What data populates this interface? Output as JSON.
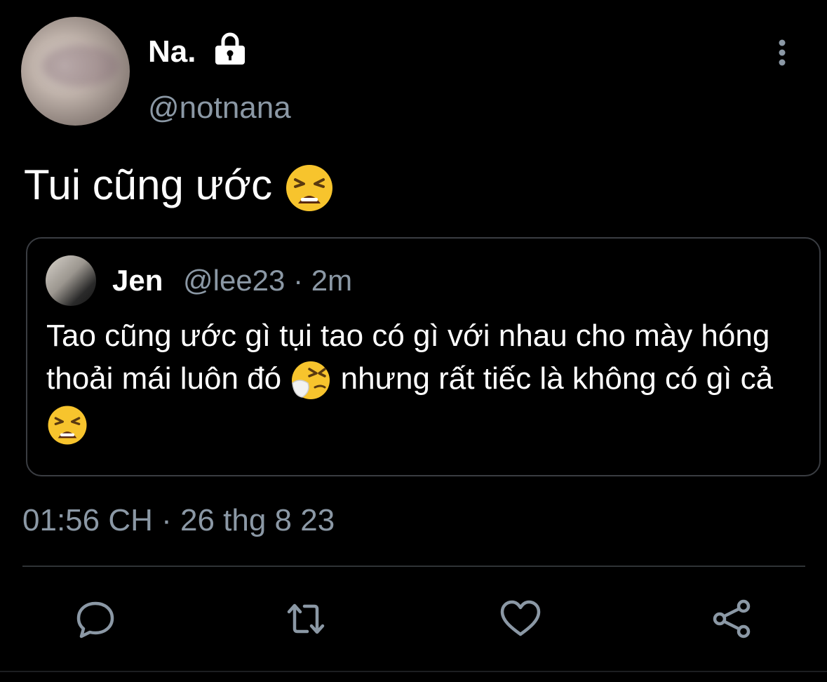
{
  "author": {
    "display_name": "Na.",
    "handle": "@notnana",
    "protected_icon": "lock-icon"
  },
  "menu_icon": "more-vertical-icon",
  "tweet": {
    "text": "Tui cũng ước",
    "emoji": "weary-face"
  },
  "quoted_tweet": {
    "display_name": "Jen",
    "handle_time": "@lee23 · 2m",
    "text_part1": "Tao cũng ước gì tụi tao có gì với nhau cho mày hóng thoải mái luôn đó",
    "emoji1": "sneezing-face",
    "text_part2": "nhưng rất tiếc là không có gì cả",
    "emoji2": "weary-face"
  },
  "timestamp": "01:56 CH · 26 thg 8 23",
  "actions": {
    "reply_icon": "reply-icon",
    "retweet_icon": "retweet-icon",
    "like_icon": "heart-icon",
    "share_icon": "share-icon"
  },
  "colors": {
    "background": "#000000",
    "text_primary": "#ffffff",
    "text_secondary": "#8b98a5",
    "border": "#3a3d42",
    "icon": "#8b98a5"
  }
}
